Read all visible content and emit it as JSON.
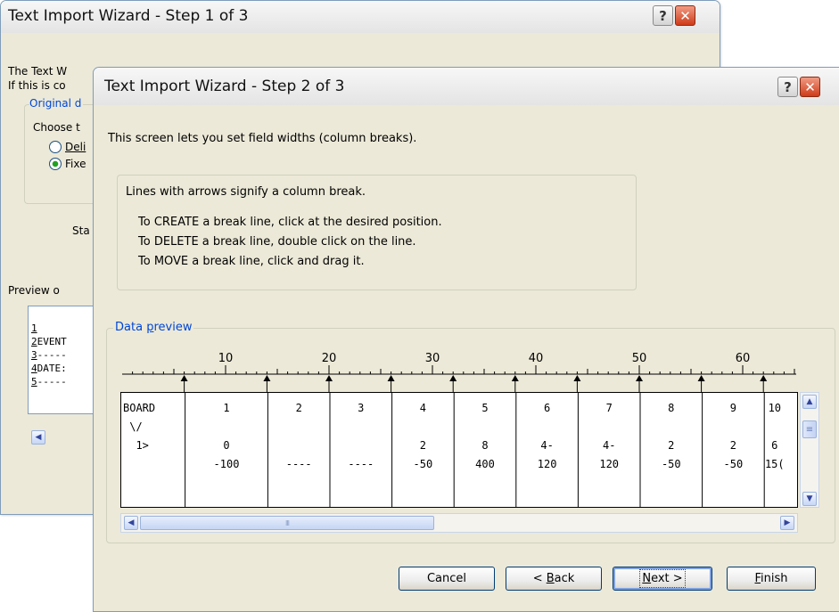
{
  "back_dialog": {
    "title": "Text Import Wizard - Step 1 of 3",
    "help_glyph": "?",
    "close_glyph": "✕",
    "intro_line1": "The Text W",
    "intro_line2": "If this is co",
    "group_label": "Original d",
    "choose_label": "Choose t",
    "radio_delimited": "Deli",
    "radio_fixed": "Fixe",
    "start_label": "Sta",
    "preview_label": "Preview o",
    "preview_rows": [
      {
        "num": "1",
        "text": ""
      },
      {
        "num": "2",
        "text": "EVENT"
      },
      {
        "num": "3",
        "text": "-----"
      },
      {
        "num": "4",
        "text": "DATE:"
      },
      {
        "num": "5",
        "text": "-----"
      }
    ],
    "scroll_left_glyph": "◀"
  },
  "dialog": {
    "title": "Text Import Wizard - Step 2 of 3",
    "help_glyph": "?",
    "close_glyph": "✕",
    "intro": "This screen lets you set field widths (column breaks).",
    "info_title": "Lines with arrows signify a column break.",
    "info_lines": [
      "To CREATE a break line, click at the desired position.",
      "To DELETE a break line, double click on the line.",
      "To MOVE a break line, click and drag it."
    ],
    "preview_label_pre": "Data ",
    "preview_label_key": "p",
    "preview_label_post": "review",
    "ruler_numbers": [
      "10",
      "20",
      "30",
      "40",
      "50",
      "60"
    ],
    "columns": [
      {
        "lines": [
          "BOARD",
          " \\/",
          "  1>",
          ""
        ]
      },
      {
        "lines": [
          "1",
          "",
          "0",
          "-100"
        ]
      },
      {
        "lines": [
          "2",
          "",
          "",
          "----"
        ]
      },
      {
        "lines": [
          "3",
          "",
          "",
          "----"
        ]
      },
      {
        "lines": [
          "4",
          "",
          "2",
          "-50"
        ]
      },
      {
        "lines": [
          "5",
          "",
          "8",
          "400"
        ]
      },
      {
        "lines": [
          "6",
          "",
          "4-",
          "120"
        ]
      },
      {
        "lines": [
          "7",
          "",
          "4-",
          "120"
        ]
      },
      {
        "lines": [
          "8",
          "",
          "2",
          "-50"
        ]
      },
      {
        "lines": [
          "9",
          "",
          "2",
          "-50"
        ]
      },
      {
        "lines": [
          "10",
          "",
          "6",
          "15("
        ]
      }
    ],
    "vscroll_up_glyph": "▲",
    "vscroll_down_glyph": "▼",
    "hscroll_left_glyph": "◀",
    "hscroll_right_glyph": "▶",
    "grip_glyph": "III",
    "vgrip_glyph": "≡",
    "buttons": {
      "cancel": "Cancel",
      "back_pre": "< ",
      "back_key": "B",
      "back_post": "ack",
      "next_key": "N",
      "next_post": "ext >",
      "finish_key": "F",
      "finish_post": "inish"
    }
  }
}
